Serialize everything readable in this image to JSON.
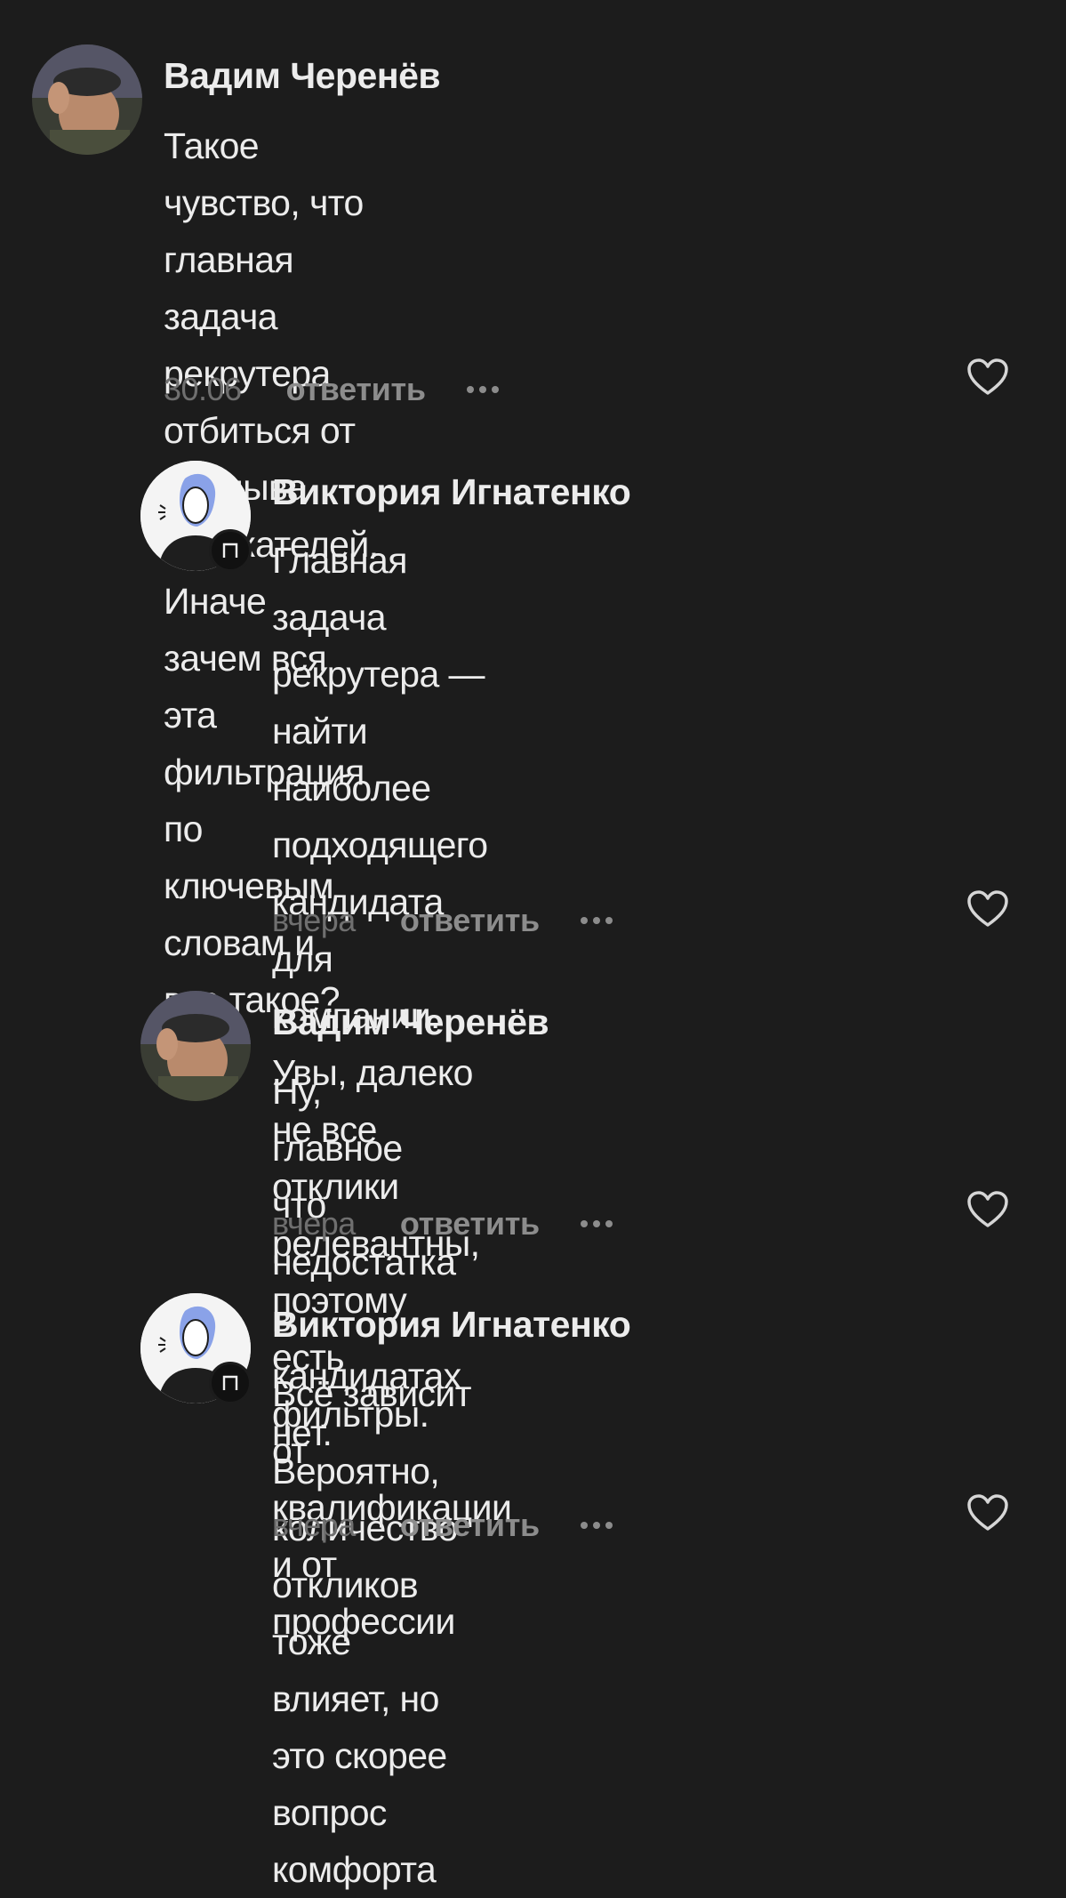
{
  "comments": [
    {
      "author": "Вадим Черенёв",
      "lines": [
        "Такое чувство, что главная задача рекрутера",
        "отбиться от наплыва соискателей. Иначе",
        "зачем вся эта фильтрация по ключевым",
        "словам и все такое?"
      ],
      "date": "30.06",
      "reply": "ответить"
    },
    {
      "author": "Виктория Игнатенко",
      "badge": "П",
      "lines": [
        "Главная задача рекрутера — найти",
        "наиболее подходящего кандидата для",
        "компании. Увы, далеко не все отклики",
        "релевантны, поэтому есть фильтры.",
        "Вероятно, количество откликов тоже",
        "влияет, но это скорее вопрос комфорта"
      ],
      "date": "вчера",
      "reply": "ответить"
    },
    {
      "author": "Вадим Черенёв",
      "lines": [
        "Ну, главное что недостатка в",
        "кандидатах нет."
      ],
      "date": "вчера",
      "reply": "ответить"
    },
    {
      "author": "Виктория Игнатенко",
      "badge": "П",
      "lines": [
        "Всё зависит от квалификации и от",
        "профессии"
      ],
      "date": "вчера",
      "reply": "ответить"
    }
  ],
  "icons": {
    "like": "heart-outline-icon",
    "more": "more-dots-icon"
  },
  "colors": {
    "background": "#1c1c1c",
    "text": "#ececec",
    "muted": "#8c8c8c"
  }
}
